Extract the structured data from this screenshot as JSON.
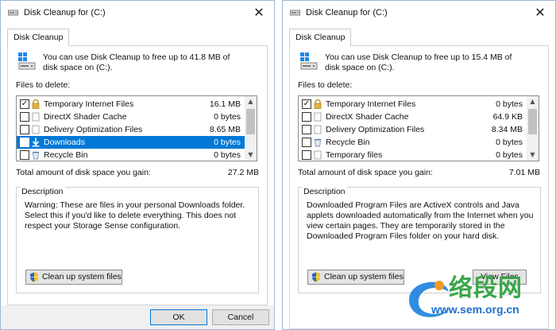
{
  "left": {
    "title": "Disk Cleanup for  (C:)",
    "tab": "Disk Cleanup",
    "intro": "You can use Disk Cleanup to free up to 41.8 MB of disk space on  (C:).",
    "files_label": "Files to delete:",
    "files": [
      {
        "name": "Temporary Internet Files",
        "size": "16.1 MB",
        "checked": true,
        "icon": "lock-icon",
        "selected": false
      },
      {
        "name": "DirectX Shader Cache",
        "size": "0 bytes",
        "checked": false,
        "icon": "blank-file-icon",
        "selected": false
      },
      {
        "name": "Delivery Optimization Files",
        "size": "8.65 MB",
        "checked": false,
        "icon": "blank-file-icon",
        "selected": false
      },
      {
        "name": "Downloads",
        "size": "0 bytes",
        "checked": false,
        "icon": "download-arrow-icon",
        "selected": true
      },
      {
        "name": "Recycle Bin",
        "size": "0 bytes",
        "checked": false,
        "icon": "recycle-bin-icon",
        "selected": false
      }
    ],
    "total_label": "Total amount of disk space you gain:",
    "total_value": "27.2 MB",
    "description_label": "Description",
    "description": "Warning: These are files in your personal Downloads folder. Select this if you'd like to delete everything. This does not respect your Storage Sense configuration.",
    "cleanup_button": "Clean up system files",
    "ok": "OK",
    "cancel": "Cancel"
  },
  "right": {
    "title": "Disk Cleanup for  (C:)",
    "tab": "Disk Cleanup",
    "intro": "You can use Disk Cleanup to free up to 15.4 MB of disk space on  (C:).",
    "files_label": "Files to delete:",
    "files": [
      {
        "name": "Temporary Internet Files",
        "size": "0 bytes",
        "checked": true,
        "icon": "lock-icon",
        "selected": false
      },
      {
        "name": "DirectX Shader Cache",
        "size": "64.9 KB",
        "checked": false,
        "icon": "blank-file-icon",
        "selected": false
      },
      {
        "name": "Delivery Optimization Files",
        "size": "8.34 MB",
        "checked": false,
        "icon": "blank-file-icon",
        "selected": false
      },
      {
        "name": "Recycle Bin",
        "size": "0 bytes",
        "checked": false,
        "icon": "recycle-bin-icon",
        "selected": false
      },
      {
        "name": "Temporary files",
        "size": "0 bytes",
        "checked": false,
        "icon": "blank-file-icon",
        "selected": false
      }
    ],
    "total_label": "Total amount of disk space you gain:",
    "total_value": "7.01 MB",
    "description_label": "Description",
    "description": "Downloaded Program Files are ActiveX controls and Java applets downloaded automatically from the Internet when you view certain pages. They are temporarily stored in the Downloaded Program Files folder on your hard disk.",
    "cleanup_button": "Clean up system files",
    "view_files_button": "View Files"
  },
  "watermark": {
    "text": "络段网",
    "url": "www.sem.org.cn"
  },
  "colors": {
    "selection": "#0078d7",
    "window_border": "#9fb7d6"
  }
}
